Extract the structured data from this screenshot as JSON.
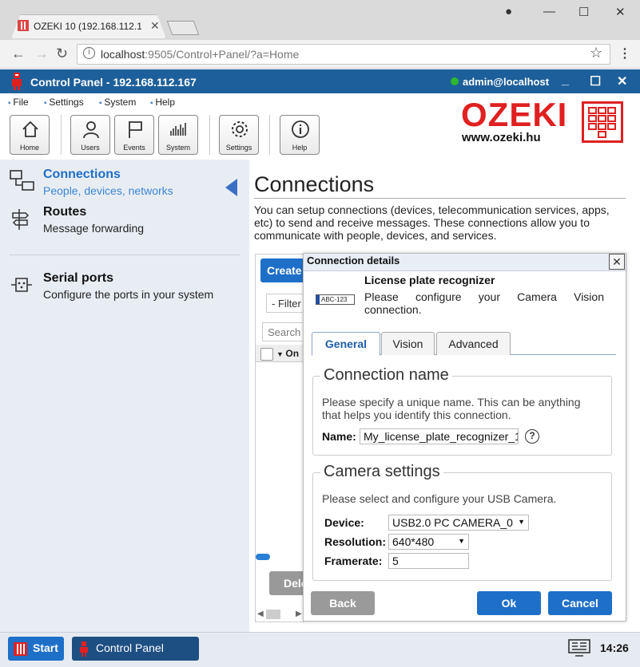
{
  "browser": {
    "tab_title": "OZEKI 10 (192.168.112.167)",
    "url_host": "localhost",
    "url_rest": ":9505/Control+Panel/?a=Home"
  },
  "app": {
    "title": "Control Panel - 192.168.112.167",
    "user": "admin@localhost"
  },
  "menu": [
    "File",
    "Settings",
    "System",
    "Help"
  ],
  "toolbar": {
    "home": "Home",
    "users": "Users",
    "events": "Events",
    "system": "System",
    "settings": "Settings",
    "help": "Help"
  },
  "brand": {
    "name": "OZEKI",
    "url": "www.ozeki.hu"
  },
  "sidebar": {
    "items": [
      {
        "title": "Connections",
        "subtitle": "People, devices, networks"
      },
      {
        "title": "Routes",
        "subtitle": "Message forwarding"
      },
      {
        "title": "Serial ports",
        "subtitle": "Configure the ports in your system"
      }
    ]
  },
  "main": {
    "title": "Connections",
    "description": "You can setup connections (devices, telecommunication services, apps, etc) to send and receive messages. These connections allow you to communicate with people, devices, and services.",
    "create_label": "Create",
    "filter_label": "- Filter",
    "search_placeholder": "Search",
    "col_label": "On",
    "delete_label": "Dele"
  },
  "dialog": {
    "title": "Connection details",
    "plate_text": "ABC-123",
    "name": "License plate recognizer",
    "description": "Please configure your Camera Vision connection.",
    "tabs": [
      "General",
      "Vision",
      "Advanced"
    ],
    "connection_name": {
      "legend": "Connection name",
      "description": "Please specify a unique name. This can be anything that helps you identify this connection.",
      "name_label": "Name:",
      "name_value": "My_license_plate_recognizer_1"
    },
    "camera": {
      "legend": "Camera settings",
      "description": "Please select and configure your USB Camera.",
      "device_label": "Device:",
      "device_value": "USB2.0 PC CAMERA_0",
      "resolution_label": "Resolution:",
      "resolution_value": "640*480",
      "framerate_label": "Framerate:",
      "framerate_value": "5"
    },
    "back_label": "Back",
    "ok_label": "Ok",
    "cancel_label": "Cancel"
  },
  "taskbar": {
    "start_label": "Start",
    "control_panel_label": "Control Panel",
    "clock": "14:26"
  }
}
